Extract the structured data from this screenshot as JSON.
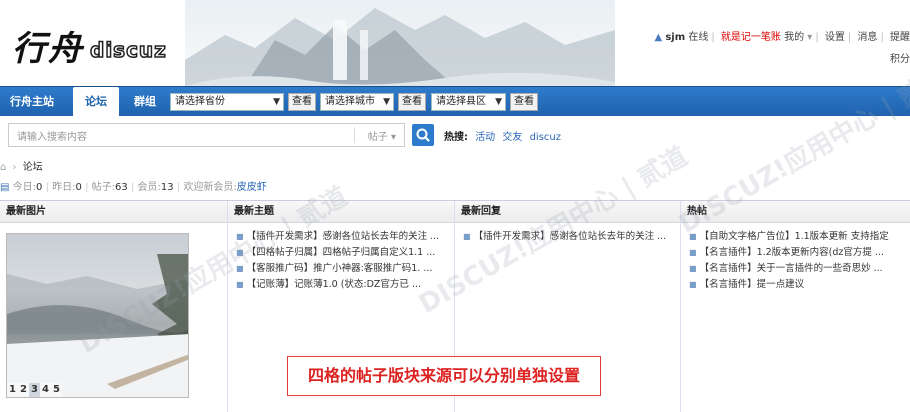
{
  "logo": {
    "cn": "行舟",
    "brand": "discuz"
  },
  "userbar": {
    "username": "sjm",
    "online": "在线",
    "pen": "就是记一笔账",
    "my": "我的",
    "settings": "设置",
    "messages": "消息",
    "reminders": "提醒",
    "credits": "积分"
  },
  "nav": {
    "items": [
      "行舟主站",
      "论坛",
      "群组"
    ],
    "province_select": "请选择省份",
    "city_select": "请选择城市",
    "county_select": "请选择县区",
    "view_button": "查看"
  },
  "search": {
    "placeholder": "请输入搜索内容",
    "type": "帖子",
    "hot_label": "热搜:",
    "hot_links": [
      "活动",
      "交友",
      "discuz"
    ]
  },
  "breadcrumb": {
    "current": "论坛"
  },
  "stats": {
    "today_label": "今日:",
    "today": "0",
    "yesterday_label": "昨日:",
    "yesterday": "0",
    "posts_label": "帖子:",
    "posts": "63",
    "members_label": "会员:",
    "members": "13",
    "welcome": "欢迎新会员:",
    "new_member": "皮皮虾"
  },
  "columns": {
    "photos": {
      "title": "最新图片",
      "pages": [
        "1",
        "2",
        "3",
        "4",
        "5"
      ],
      "current_page": "3"
    },
    "topics": {
      "title": "最新主题",
      "items": [
        "【插件开发需求】感谢各位站长去年的关注 ...",
        "【四格帖子归属】四格帖子归属自定义1.1 ...",
        "【客服推广码】推广小神器:客服推广码1. ...",
        "【记账薄】记账薄1.0 (状态:DZ官方已 ..."
      ]
    },
    "replies": {
      "title": "最新回复",
      "items": [
        "【插件开发需求】感谢各位站长去年的关注 ..."
      ]
    },
    "hot": {
      "title": "热帖",
      "items": [
        "【自助文字格广告位】1.1版本更新 支持指定",
        "【名言插件】1.2版本更新内容(dz官方提 ...",
        "【名言插件】关于一言插件的一些奇思妙 ...",
        "【名言插件】提一点建议"
      ]
    }
  },
  "callout": "四格的帖子版块来源可以分别单独设置",
  "watermark": "DISCUZ!应用中心 | 贰道"
}
